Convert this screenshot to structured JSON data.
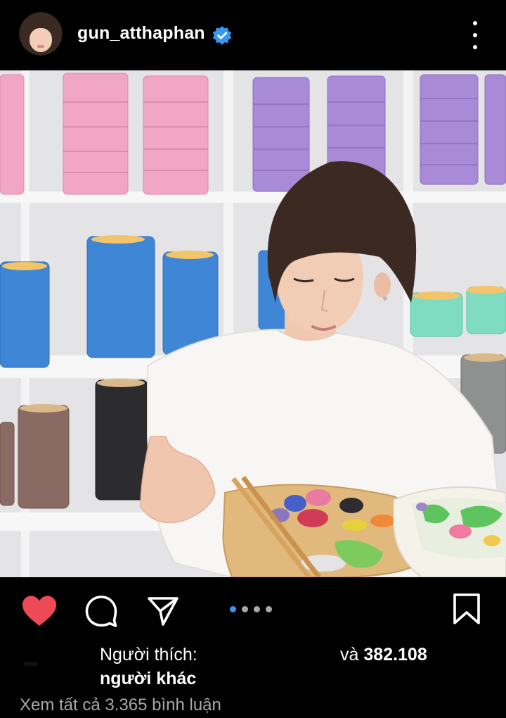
{
  "post": {
    "username": "gun_atthaphan",
    "verified": true,
    "more_icon": "more-vertical-icon"
  },
  "actions": {
    "like_icon": "heart-filled-icon",
    "comment_icon": "comment-icon",
    "share_icon": "send-icon",
    "save_icon": "bookmark-icon",
    "carousel": {
      "count": 4,
      "active_index": 0
    },
    "like_color": "#ed4956",
    "dot_active_color": "#3897f0"
  },
  "likes": {
    "label": "Người thích:",
    "and": "và ",
    "count": "382.108",
    "others": "người khác"
  },
  "comments": {
    "view_all": "Xem tất cả 3.365 bình luận"
  }
}
